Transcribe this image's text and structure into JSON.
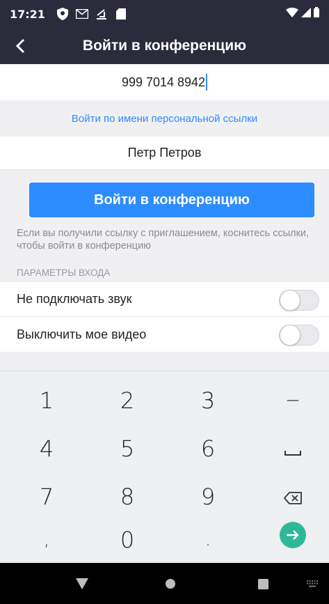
{
  "status_bar": {
    "time": "17:21",
    "icons": [
      "shield-icon",
      "gmail-icon",
      "download-icon",
      "sd-card-icon",
      "wifi-icon",
      "signal-icon",
      "battery-icon"
    ]
  },
  "app_bar": {
    "title": "Войти в конференцию",
    "back_icon": "chevron-left-icon"
  },
  "form": {
    "meeting_id_value": "999 7014 8942",
    "personal_link_label": "Войти по имени персональной ссылки",
    "name_value": "Петр Петров",
    "join_button_label": "Войти в конференцию",
    "hint_text": "Если вы получили ссылку с приглашением, коснитесь ссылки, чтобы войти в конференцию"
  },
  "options": {
    "section_title": "ПАРАМЕТРЫ ВХОДА",
    "items": [
      {
        "label": "Не подключать звук",
        "enabled": false
      },
      {
        "label": "Выключить мое видео",
        "enabled": false
      }
    ]
  },
  "keypad": {
    "keys": [
      "1",
      "2",
      "3",
      "−",
      "4",
      "5",
      "6",
      "space-icon",
      "7",
      "8",
      "9",
      "backspace-icon",
      ",",
      "0",
      ".",
      "go-arrow-icon"
    ]
  },
  "nav_bar": {
    "icons": [
      "back-triangle-icon",
      "home-circle-icon",
      "recents-square-icon",
      "keyboard-icon"
    ]
  },
  "colors": {
    "app_bar": "#2b2b3c",
    "accent_blue": "#2d8cff",
    "go_green": "#2fb897",
    "background": "#f0f0f3"
  }
}
